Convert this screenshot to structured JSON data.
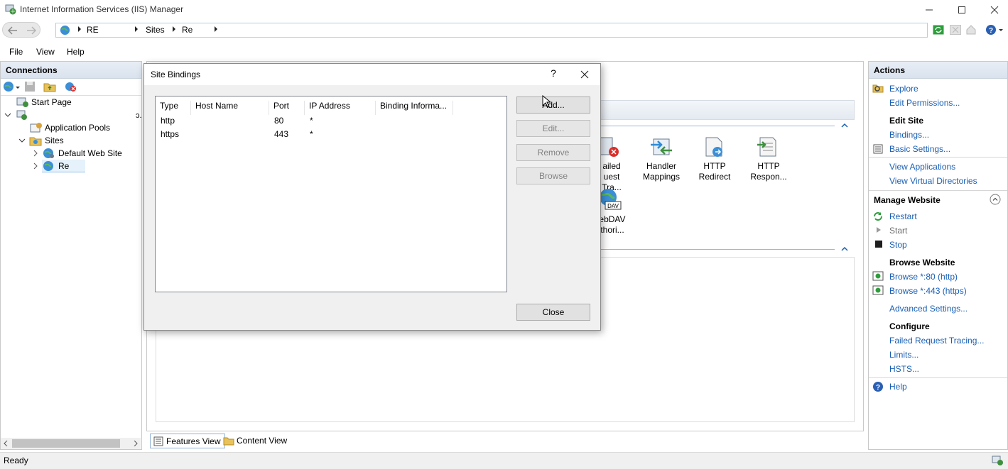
{
  "window": {
    "title": "Internet Information Services (IIS) Manager"
  },
  "address": {
    "crumbs": [
      "RE",
      "Sites",
      "Re"
    ]
  },
  "menu": [
    "File",
    "View",
    "Help"
  ],
  "connections": {
    "header": "Connections",
    "tree": {
      "start_page": "Start Page",
      "app_pools": "Application Pools",
      "sites": "Sites",
      "default_site": "Default Web Site",
      "current_site": "Re"
    }
  },
  "center": {
    "features": [
      {
        "label1": "ailed",
        "label2": "uest Tra..."
      },
      {
        "label1": "Handler",
        "label2": "Mappings"
      },
      {
        "label1": "HTTP",
        "label2": "Redirect"
      },
      {
        "label1": "HTTP",
        "label2": "Respon..."
      },
      {
        "label1": "ebDAV",
        "label2": "thori..."
      }
    ],
    "tabs": {
      "features": "Features View",
      "content": "Content View"
    }
  },
  "actions": {
    "header": "Actions",
    "explore": "Explore",
    "edit_permissions": "Edit Permissions...",
    "edit_site_head": "Edit Site",
    "bindings": "Bindings...",
    "basic_settings": "Basic Settings...",
    "view_apps": "View Applications",
    "view_vdirs": "View Virtual Directories",
    "manage_head": "Manage Website",
    "restart": "Restart",
    "start": "Start",
    "stop": "Stop",
    "browse_head": "Browse Website",
    "browse80": "Browse *:80 (http)",
    "browse443": "Browse *:443 (https)",
    "advanced": "Advanced Settings...",
    "configure_head": "Configure",
    "frt": "Failed Request Tracing...",
    "limits": "Limits...",
    "hsts": "HSTS...",
    "help": "Help"
  },
  "status": {
    "text": "Ready"
  },
  "dialog": {
    "title": "Site Bindings",
    "help_glyph": "?",
    "columns": [
      "Type",
      "Host Name",
      "Port",
      "IP Address",
      "Binding Informa..."
    ],
    "rows": [
      {
        "type": "http",
        "host": "",
        "port": "80",
        "ip": "*",
        "info": ""
      },
      {
        "type": "https",
        "host": "",
        "port": "443",
        "ip": "*",
        "info": ""
      }
    ],
    "buttons": {
      "add": "Add...",
      "edit": "Edit...",
      "remove": "Remove",
      "browse": "Browse",
      "close": "Close"
    }
  },
  "colors": {
    "link": "#1a5fb4",
    "accent": "#0078d7"
  }
}
